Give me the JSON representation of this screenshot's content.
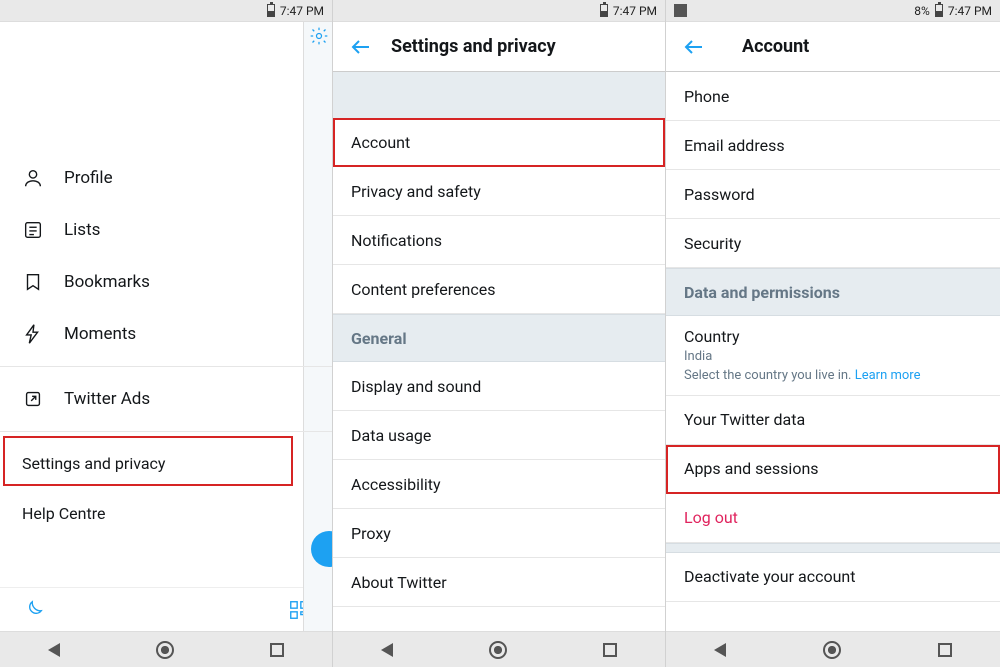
{
  "panel1": {
    "statusbar": {
      "time": "7:47 PM"
    },
    "drawer_items": [
      {
        "icon": "profile",
        "label": "Profile"
      },
      {
        "icon": "lists",
        "label": "Lists"
      },
      {
        "icon": "bookmarks",
        "label": "Bookmarks"
      },
      {
        "icon": "moments",
        "label": "Moments"
      }
    ],
    "twitter_ads": "Twitter Ads",
    "settings_privacy": "Settings and privacy",
    "help_centre": "Help Centre"
  },
  "panel2": {
    "statusbar": {
      "time": "7:47 PM"
    },
    "header_title": "Settings and privacy",
    "items": [
      "Account",
      "Privacy and safety",
      "Notifications",
      "Content preferences"
    ],
    "general_header": "General",
    "general_items": [
      "Display and sound",
      "Data usage",
      "Accessibility",
      "Proxy",
      "About Twitter"
    ]
  },
  "panel3": {
    "statusbar": {
      "time": "7:47 PM",
      "battery_pct": "8%"
    },
    "header_title": "Account",
    "login_items": [
      "Phone",
      "Email address",
      "Password",
      "Security"
    ],
    "data_perm_header": "Data and permissions",
    "country": {
      "label": "Country",
      "value": "India",
      "hint": "Select the country you live in.",
      "learn_more": "Learn more"
    },
    "your_twitter_data": "Your Twitter data",
    "apps_sessions": "Apps and sessions",
    "log_out": "Log out",
    "deactivate": "Deactivate your account"
  }
}
